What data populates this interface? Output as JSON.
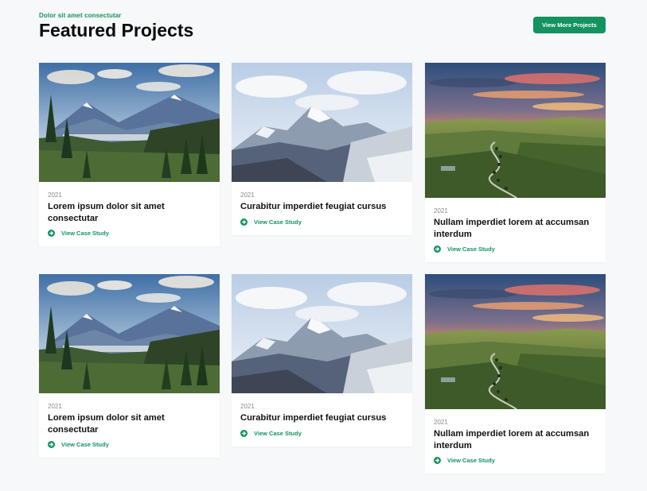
{
  "header": {
    "eyebrow": "Dolor sit amet consectutar",
    "title": "Featured Projects",
    "button_label": "View More Projects"
  },
  "colors": {
    "accent": "#14925f",
    "background": "#f7f8fa"
  },
  "cards": [
    {
      "year": "2021",
      "title": "Lorem ipsum dolor sit amet consectutar",
      "link_label": "View Case Study",
      "image": "alpine-valley-lake"
    },
    {
      "year": "2021",
      "title": "Curabitur imperdiet feugiat cursus",
      "link_label": "View Case Study",
      "image": "snowy-mountain-peak"
    },
    {
      "year": "2021",
      "title": "Nullam imperdiet lorem at accumsan interdum",
      "link_label": "View Case Study",
      "image": "sunset-rolling-hills"
    },
    {
      "year": "2021",
      "title": "Lorem ipsum dolor sit amet consectutar",
      "link_label": "View Case Study",
      "image": "alpine-valley-lake"
    },
    {
      "year": "2021",
      "title": "Curabitur imperdiet feugiat cursus",
      "link_label": "View Case Study",
      "image": "snowy-mountain-peak"
    },
    {
      "year": "2021",
      "title": "Nullam imperdiet lorem at accumsan interdum",
      "link_label": "View Case Study",
      "image": "sunset-rolling-hills"
    }
  ]
}
